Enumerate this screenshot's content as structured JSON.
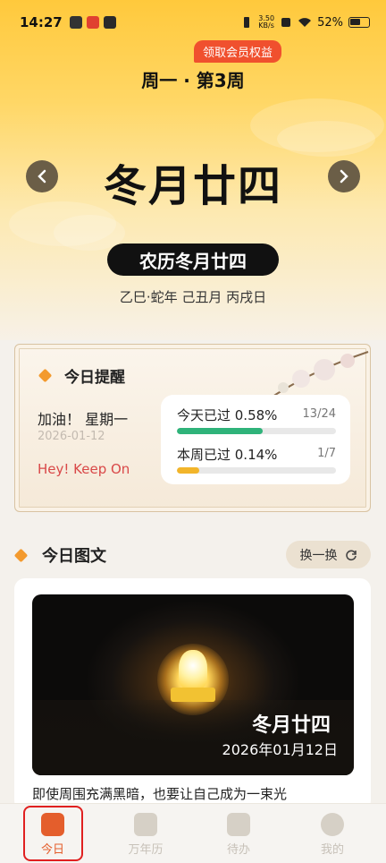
{
  "status": {
    "time": "14:27",
    "net_speed": "3.50\nKB/s",
    "battery": "52%"
  },
  "header": {
    "vip_label": "领取会员权益",
    "week_text": "周一 · 第3周"
  },
  "date": {
    "big": "冬月廿四",
    "lunar_pill": "农历冬月廿四",
    "ganzhi": "乙巳·蛇年 己丑月 丙戌日"
  },
  "reminder": {
    "title": "今日提醒",
    "cheer": "加油！ 星期一",
    "date": "2026-01-12",
    "keep": "Hey! Keep On",
    "progress": [
      {
        "label": "今天已过 0.58%",
        "frac": "13/24",
        "value": 0.58,
        "color": "#2fb37a"
      },
      {
        "label": "本周已过 0.14%",
        "frac": "1/7",
        "value": 0.14,
        "color": "#f2b52a"
      }
    ]
  },
  "article": {
    "title": "今日图文",
    "swap_label": "换一换",
    "image_title": "冬月廿四",
    "image_date": "2026年01月12日",
    "caption": "即使周围充满黑暗，也要让自己成为一束光"
  },
  "tabs": [
    {
      "label": "今日",
      "icon": "today-icon"
    },
    {
      "label": "万年历",
      "icon": "calendar-icon"
    },
    {
      "label": "待办",
      "icon": "todo-icon"
    },
    {
      "label": "我的",
      "icon": "profile-icon"
    }
  ],
  "colors": {
    "accent": "#e45e2c",
    "vip": "#f0502e",
    "hero": "#ffc93c"
  }
}
